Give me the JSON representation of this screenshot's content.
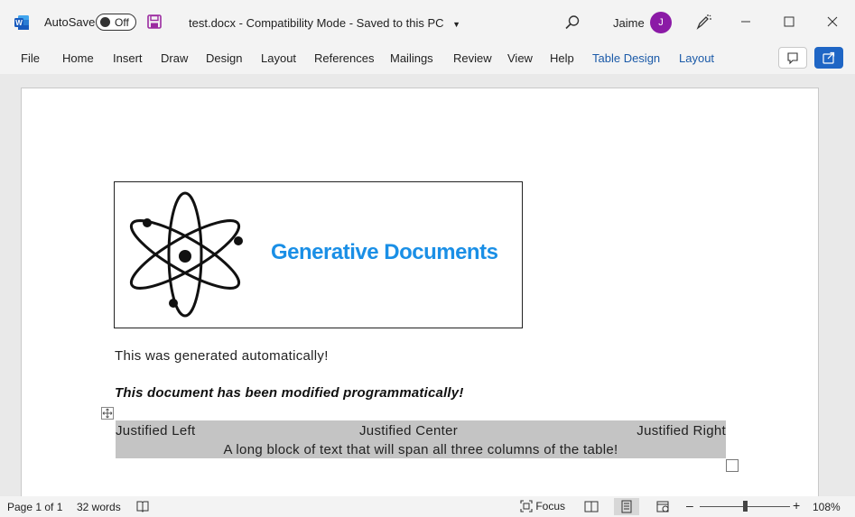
{
  "titlebar": {
    "autosave_label": "AutoSave",
    "autosave_state": "Off",
    "document_title": "test.docx  -  Compatibility Mode  -  Saved to this PC",
    "user_name": "Jaime",
    "avatar_initial": "J",
    "icons": [
      "word-logo-icon",
      "save-icon",
      "search-icon",
      "pen-icon",
      "minimize-icon",
      "maximize-icon",
      "close-icon"
    ]
  },
  "ribbon": {
    "tabs": [
      "File",
      "Home",
      "Insert",
      "Draw",
      "Design",
      "Layout",
      "References",
      "Mailings",
      "Review",
      "View",
      "Help",
      "Table Design",
      "Layout"
    ],
    "accent_color": "#1b5aa8"
  },
  "document": {
    "brand_title": "Generative Documents",
    "brand_color": "#1a8fe6",
    "paragraph1": "This was generated automatically!",
    "paragraph2": "This document has been modified programmatically!",
    "table": {
      "row1": [
        "Justified Left",
        "Justified Center",
        "Justified Right"
      ],
      "row2": "A long block of text that will span all three columns of the table!"
    }
  },
  "statusbar": {
    "page": "Page 1 of 1",
    "words": "32 words",
    "focus": "Focus",
    "zoom": "108%"
  }
}
